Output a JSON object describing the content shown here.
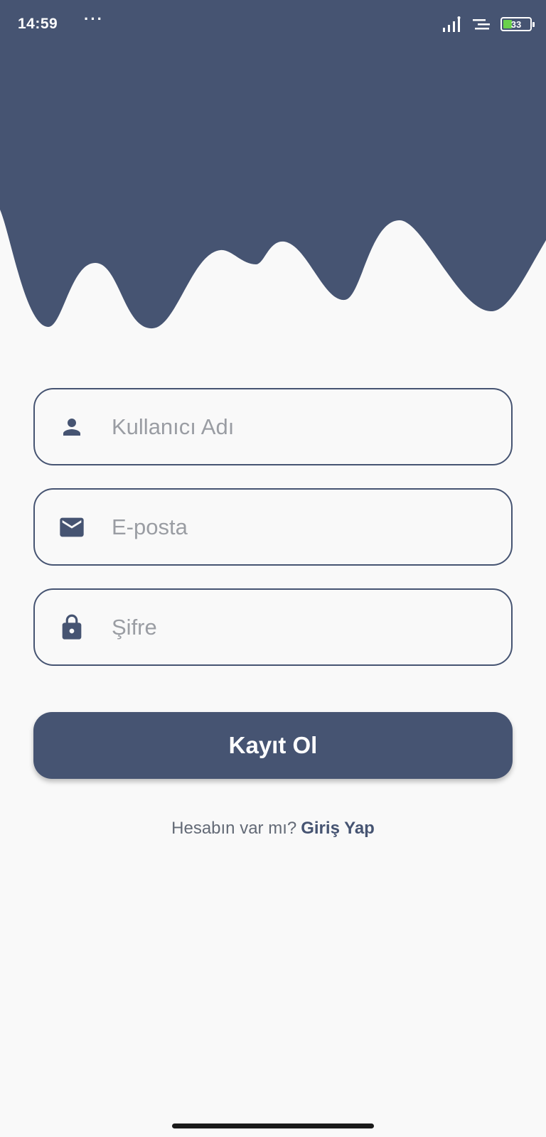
{
  "status_bar": {
    "time": "14:59",
    "more": "···",
    "battery_level": "33"
  },
  "colors": {
    "primary": "#465472",
    "background": "#f9f9f9",
    "placeholder": "#9a9da3",
    "battery": "#6ad14a"
  },
  "form": {
    "username": {
      "icon": "person-icon",
      "placeholder": "Kullanıcı Adı",
      "value": ""
    },
    "email": {
      "icon": "mail-icon",
      "placeholder": "E-posta",
      "value": ""
    },
    "password": {
      "icon": "lock-icon",
      "placeholder": "Şifre",
      "value": ""
    }
  },
  "actions": {
    "register_label": "Kayıt Ol",
    "have_account_text": "Hesabın var mı?",
    "login_link_label": "Giriş Yap"
  }
}
